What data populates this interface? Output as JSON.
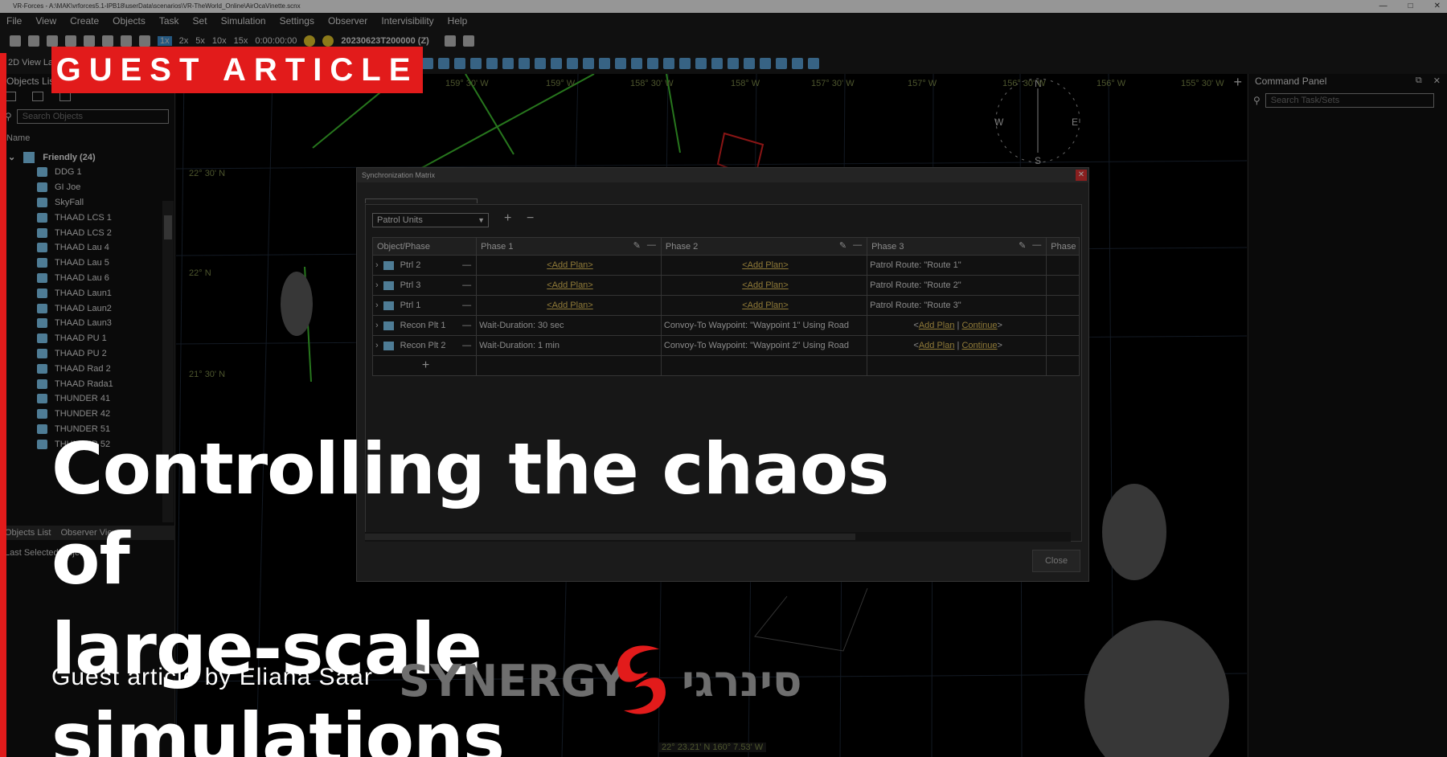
{
  "window": {
    "title": "VR-Forces - A:\\MAK\\vrforces5.1-IPB18\\userData\\scenarios\\VR-TheWorld_Online\\AirOcaVinette.scnx",
    "controls": [
      "—",
      "□",
      "✕"
    ]
  },
  "menu": [
    "File",
    "View",
    "Create",
    "Objects",
    "Task",
    "Set",
    "Simulation",
    "Settings",
    "Observer",
    "Intervisibility",
    "Help"
  ],
  "toolbar": {
    "speeds": [
      "1x",
      "2x",
      "5x",
      "10x",
      "15x"
    ],
    "elapsed": "0:00:00:00",
    "datetime": "20230623T200000 (Z)",
    "view_label": "2D View Layer"
  },
  "objects_panel": {
    "title": "Objects List",
    "search_placeholder": "Search Objects",
    "column": "Name",
    "group": "Friendly (24)",
    "items": [
      "DDG 1",
      "GI Joe",
      "SkyFall",
      "THAAD LCS 1",
      "THAAD LCS 2",
      "THAAD Lau 4",
      "THAAD Lau 5",
      "THAAD Lau 6",
      "THAAD Laun1",
      "THAAD Laun2",
      "THAAD Laun3",
      "THAAD PU 1",
      "THAAD PU 2",
      "THAAD Rad 2",
      "THAAD Rada1",
      "THUNDER 41",
      "THUNDER 42",
      "THUNDER 51",
      "THUNDER 52"
    ],
    "bottom_tabs": [
      "Objects List",
      "Observer Views"
    ],
    "last_selected": "Last Selected Object"
  },
  "map": {
    "lon_labels": [
      "159° 30' W",
      "159° W",
      "158° 30' W",
      "158° W",
      "157° 30' W",
      "157° W",
      "156° 30' W",
      "156° W",
      "155° 30' W"
    ],
    "lat_labels": [
      "22° 30' N",
      "22° N",
      "21° 30' N"
    ],
    "cursor_readout": "22° 23.21' N  160° 7.53' W",
    "compass": {
      "n": "N",
      "s": "S",
      "e": "E",
      "w": "W"
    }
  },
  "command_panel": {
    "title": "Command Panel",
    "search_placeholder": "Search Task/Sets"
  },
  "sync_matrix": {
    "title": "Synchronization Matrix",
    "dropdown_value": "Patrol Units",
    "headers": [
      "Object/Phase",
      "Phase 1",
      "Phase 2",
      "Phase 3",
      "Phase"
    ],
    "rows": [
      {
        "name": "Ptrl  2",
        "p1": "<Add Plan>",
        "p2": "<Add Plan>",
        "p3": "Patrol Route: \"Route 1\""
      },
      {
        "name": "Ptrl  3",
        "p1": "<Add Plan>",
        "p2": "<Add Plan>",
        "p3": "Patrol Route: \"Route 2\""
      },
      {
        "name": "Ptrl 1",
        "p1": "<Add Plan>",
        "p2": "<Add Plan>",
        "p3": "Patrol Route: \"Route 3\""
      },
      {
        "name": "Recon Plt 1",
        "p1": "Wait-Duration: 30 sec",
        "p2": "Convoy-To Waypoint: \"Waypoint 1\" Using Road",
        "p3a": "Add Plan",
        "p3b": "Continue"
      },
      {
        "name": "Recon Plt 2",
        "p1": "Wait-Duration: 1 min",
        "p2": "Convoy-To Waypoint: \"Waypoint 2\" Using Road",
        "p3a": "Add Plan",
        "p3b": "Continue"
      }
    ],
    "close_label": "Close"
  },
  "overlay": {
    "badge": "GUEST ARTICLE",
    "headline_line1": "Controlling the chaos of",
    "headline_line2": "large-scale simulations",
    "byline": "Guest article by Eliana Saar",
    "logo_latin": "SYNERGY",
    "logo_hebrew": "סינרגי"
  },
  "colors": {
    "accent_red": "#e21b1b",
    "link_yellow": "#e6c35a",
    "route_green": "#3fbf2f",
    "unit_blue": "#7ec8f0"
  }
}
